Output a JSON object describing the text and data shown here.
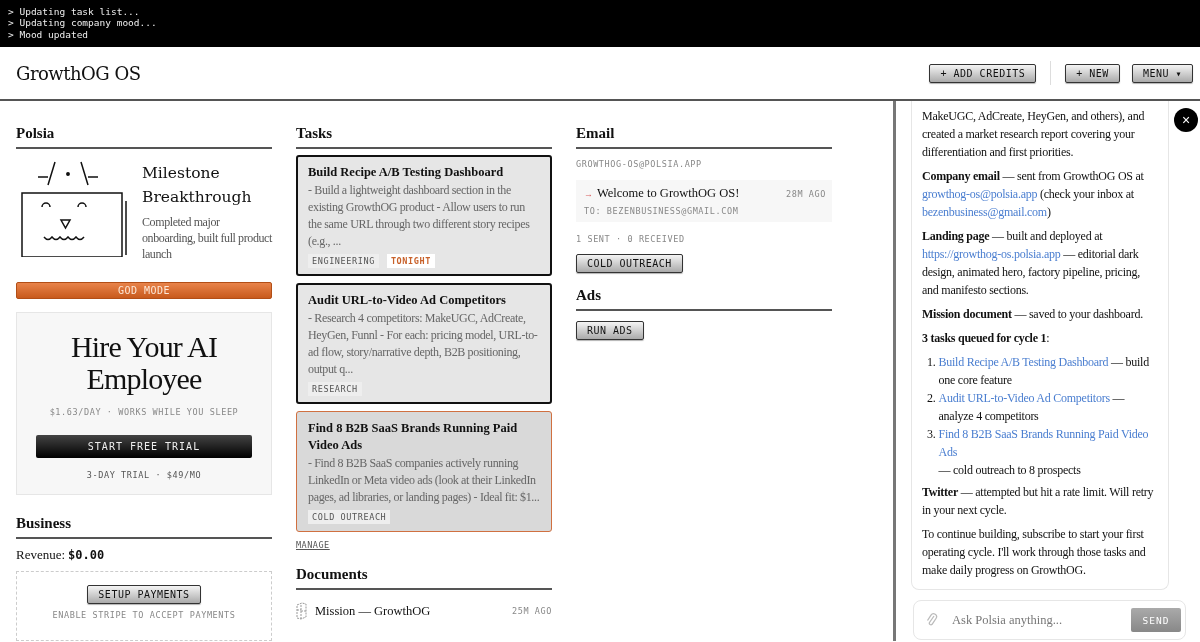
{
  "terminal": {
    "lines": [
      "> Updating task list...",
      "> Updating company mood...",
      "> Mood updated"
    ]
  },
  "header": {
    "title": "GrowthOG OS",
    "buttons": [
      {
        "label": "+ ADD CREDITS"
      },
      {
        "label": "+ NEW"
      },
      {
        "label": "MENU ▾"
      }
    ]
  },
  "polsia": {
    "heading": "Polsia",
    "milestone_title": "Milestone Breakthrough",
    "milestone_text": "Completed major onboarding, built full product launch",
    "god_mode": "GOD MODE",
    "promo": {
      "title": "Hire Your AI Employee",
      "price": "$1.63/DAY · WORKS WHILE YOU SLEEP",
      "button": "START FREE TRIAL",
      "note": "3-DAY TRIAL · $49/MO"
    }
  },
  "business": {
    "heading": "Business",
    "revenue_label": "Revenue:",
    "revenue_value": "$0.00",
    "setup_button": "SETUP PAYMENTS",
    "setup_note": "ENABLE STRIPE TO ACCEPT PAYMENTS"
  },
  "tasks": {
    "heading": "Tasks",
    "items": [
      {
        "title": "Build Recipe A/B Testing Dashboard",
        "description": "- Build a lightweight dashboard section in the existing GrowthOG product - Allow users to run the same URL through two different story recipes (e.g., ...",
        "selected": false,
        "tags": [
          {
            "label": "ENGINEERING",
            "kind": "plain"
          },
          {
            "label": "TONIGHT",
            "kind": "urgent"
          }
        ]
      },
      {
        "title": "Audit URL-to-Video Ad Competitors",
        "description": "- Research 4 competitors: MakeUGC, AdCreate, HeyGen, Funnl - For each: pricing model, URL-to-ad flow, story/narrative depth, B2B positioning, output q...",
        "selected": false,
        "tags": [
          {
            "label": "RESEARCH",
            "kind": "plain"
          }
        ]
      },
      {
        "title": "Find 8 B2B SaaS Brands Running Paid Video Ads",
        "description": "- Find 8 B2B SaaS companies actively running LinkedIn or Meta video ads (look at their LinkedIn pages, ad libraries, or landing pages) - Ideal fit: $1...",
        "selected": true,
        "tags": [
          {
            "label": "COLD OUTREACH",
            "kind": "plain"
          }
        ]
      }
    ],
    "manage": "MANAGE"
  },
  "documents": {
    "heading": "Documents",
    "items": [
      {
        "title": "Mission — GrowthOG",
        "time": "25M AGO"
      }
    ]
  },
  "email": {
    "heading": "Email",
    "address": "GROWTHOG-OS@POLSIA.APP",
    "messages": [
      {
        "arrow": "→",
        "subject": "Welcome to GrowthOG OS!",
        "time": "28M AGO",
        "to": "TO: BEZENBUSINESS@GMAIL.COM"
      }
    ],
    "stats": "1 SENT · 0 RECEIVED",
    "button": "COLD OUTREACH"
  },
  "ads": {
    "heading": "Ads",
    "button": "RUN ADS"
  },
  "chat": {
    "close": "×",
    "paragraphs": [
      {
        "kind": "para",
        "parts": [
          {
            "kind": "text",
            "text": "MakeUGC, AdCreate, HeyGen, and others), and created a market research report covering your differentiation and first priorities."
          }
        ]
      },
      {
        "kind": "para",
        "parts": [
          {
            "kind": "text",
            "text": "**Company email** — sent from GrowthOG OS at "
          },
          {
            "kind": "link",
            "text": "growthog-os@polsia.app"
          },
          {
            "kind": "text",
            "text": " (check your inbox at "
          },
          {
            "kind": "link",
            "text": "bezenbusiness@gmail.com"
          },
          {
            "kind": "text",
            "text": ")"
          }
        ]
      },
      {
        "kind": "para",
        "parts": [
          {
            "kind": "text",
            "text": "**Landing page** — built and deployed at "
          },
          {
            "kind": "link",
            "text": "https://growthog-os.polsia.app"
          },
          {
            "kind": "text",
            "text": " — editorial dark design, animated hero, factory pipeline, pricing, and manifesto sections."
          }
        ]
      },
      {
        "kind": "para",
        "parts": [
          {
            "kind": "text",
            "text": "**Mission document** — saved to your dashboard."
          }
        ]
      },
      {
        "kind": "para",
        "parts": [
          {
            "kind": "text",
            "text": "**3 tasks queued for cycle 1**:"
          }
        ]
      },
      {
        "kind": "list",
        "items": [
          {
            "number": "1.",
            "parts": [
              {
                "kind": "link",
                "text": "Build Recipe A/B Testing Dashboard"
              },
              {
                "kind": "text",
                "text": " — build one core feature"
              }
            ]
          },
          {
            "number": "2.",
            "parts": [
              {
                "kind": "link",
                "text": "Audit URL-to-Video Ad Competitors"
              },
              {
                "kind": "text",
                "text": " — analyze 4 competitors"
              }
            ]
          },
          {
            "number": "3.",
            "parts": [
              {
                "kind": "link",
                "text": "Find 8 B2B SaaS Brands Running Paid Video Ads"
              },
              {
                "kind": "text",
                "text": " — cold outreach to 8 prospects"
              }
            ]
          }
        ]
      },
      {
        "kind": "para",
        "parts": [
          {
            "kind": "text",
            "text": "**Twitter** — attempted but hit a rate limit. Will retry in your next cycle."
          }
        ]
      },
      {
        "kind": "para",
        "parts": [
          {
            "kind": "text",
            "text": "To continue building, subscribe to start your first operating cycle. I'll work through those tasks and make daily progress on GrowthOG."
          }
        ]
      }
    ],
    "input_placeholder": "Ask Polsia anything...",
    "send": "SEND"
  }
}
